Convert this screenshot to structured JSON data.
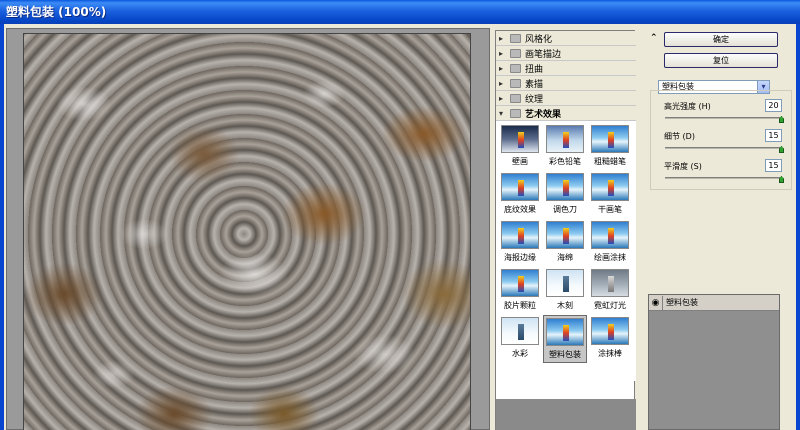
{
  "window": {
    "title": "塑料包装 (100%)"
  },
  "categories": [
    {
      "label": "风格化",
      "open": false
    },
    {
      "label": "画笔描边",
      "open": false
    },
    {
      "label": "扭曲",
      "open": false
    },
    {
      "label": "素描",
      "open": false
    },
    {
      "label": "纹理",
      "open": false
    },
    {
      "label": "艺术效果",
      "open": true
    }
  ],
  "filters": [
    {
      "label": "壁画",
      "style": "dark"
    },
    {
      "label": "彩色铅笔",
      "style": "sketch"
    },
    {
      "label": "粗糙蜡笔",
      "style": "normal"
    },
    {
      "label": "底纹效果",
      "style": "normal"
    },
    {
      "label": "调色刀",
      "style": "normal"
    },
    {
      "label": "干画笔",
      "style": "normal"
    },
    {
      "label": "海报边缘",
      "style": "normal"
    },
    {
      "label": "海绵",
      "style": "normal"
    },
    {
      "label": "绘画涂抹",
      "style": "normal"
    },
    {
      "label": "胶片颗粒",
      "style": "normal"
    },
    {
      "label": "木刻",
      "style": "light"
    },
    {
      "label": "霓虹灯光",
      "style": "grey"
    },
    {
      "label": "水彩",
      "style": "light"
    },
    {
      "label": "塑料包装",
      "style": "normal",
      "selected": true
    },
    {
      "label": "涂抹棒",
      "style": "normal"
    }
  ],
  "controls": {
    "ok_label": "确定",
    "reset_label": "复位",
    "selected_filter": "塑料包装",
    "params": [
      {
        "label": "高光强度 (H)",
        "value": "20",
        "fraction": 1.0
      },
      {
        "label": "细节 (D)",
        "value": "15",
        "fraction": 1.0
      },
      {
        "label": "平滑度 (S)",
        "value": "15",
        "fraction": 1.0
      }
    ]
  },
  "layers": {
    "items": [
      {
        "name": "塑料包装"
      }
    ]
  },
  "icons": {
    "collapse": "chevron-up-double-icon",
    "eye": "eye-icon",
    "folder": "folder-icon",
    "triangle": "triangle-right-icon"
  }
}
